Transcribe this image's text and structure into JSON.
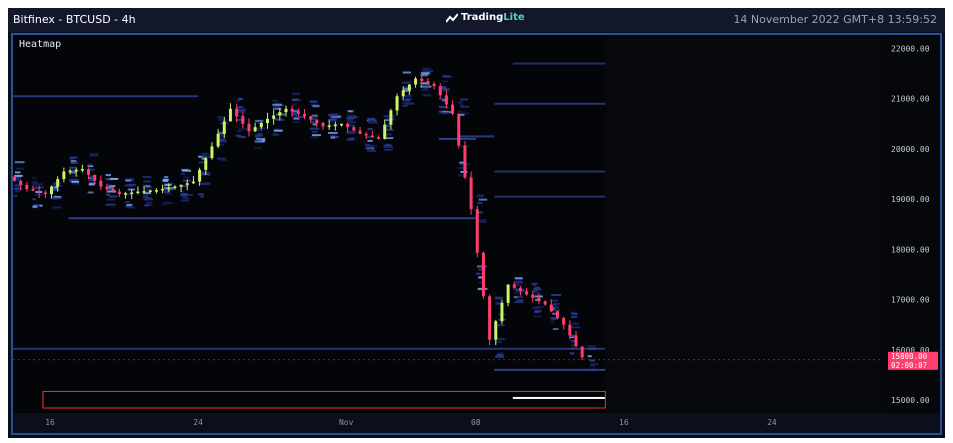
{
  "header": {
    "symbol": "Bitfinex - BTCUSD - 4h",
    "logo_text_a": "Trading",
    "logo_text_b": "Lite",
    "datetime": "14 November 2022 GMT+8 13:59:52"
  },
  "panel": {
    "label": "Heatmap"
  },
  "colors": {
    "background": "#030508",
    "up_candle": "#c8f56a",
    "down_candle": "#ff3d6e",
    "liquidity": "#3b4fb0",
    "highlight_box": "#ff2a2a",
    "price_tag": "#ff3d6e"
  },
  "chart_data": {
    "type": "heatmap",
    "title": "Heatmap",
    "ylim": [
      14800,
      22150
    ],
    "y_ticks": [
      "22000.00",
      "21000.00",
      "20000.00",
      "19000.00",
      "18000.00",
      "17000.00",
      "16000.00",
      "15000.00"
    ],
    "y_tick_values": [
      22000,
      21000,
      20000,
      19000,
      18000,
      17000,
      16000,
      15000
    ],
    "x_ticks": [
      "16",
      "24",
      "Nov",
      "08",
      "16",
      "24"
    ],
    "x_tick_dates": [
      "2022-10-16",
      "2022-10-24",
      "2022-11-01",
      "2022-11-08",
      "2022-11-16",
      "2022-11-24"
    ],
    "x_range_dates": [
      "2022-10-14",
      "2022-11-30"
    ],
    "last_price_label": "15800.00",
    "countdown_label": "02:00:07",
    "last_price": 15800,
    "series": [
      {
        "name": "",
        "description": "BTCUSD 4h close path",
        "points": [
          [
            "2022-10-14",
            19450
          ],
          [
            "2022-10-15",
            19200
          ],
          [
            "2022-10-16",
            19100
          ],
          [
            "2022-10-17",
            19550
          ],
          [
            "2022-10-18",
            19600
          ],
          [
            "2022-10-19",
            19250
          ],
          [
            "2022-10-20",
            19100
          ],
          [
            "2022-10-21",
            19150
          ],
          [
            "2022-10-22",
            19180
          ],
          [
            "2022-10-23",
            19250
          ],
          [
            "2022-10-24",
            19350
          ],
          [
            "2022-10-25",
            20050
          ],
          [
            "2022-10-26",
            20800
          ],
          [
            "2022-10-27",
            20350
          ],
          [
            "2022-10-28",
            20600
          ],
          [
            "2022-10-29",
            20800
          ],
          [
            "2022-10-30",
            20650
          ],
          [
            "2022-10-31",
            20450
          ],
          [
            "2022-11-01",
            20500
          ],
          [
            "2022-11-02",
            20300
          ],
          [
            "2022-11-03",
            20200
          ],
          [
            "2022-11-04",
            21050
          ],
          [
            "2022-11-05",
            21400
          ],
          [
            "2022-11-06",
            21250
          ],
          [
            "2022-11-07",
            20700
          ],
          [
            "2022-11-08",
            18800
          ],
          [
            "2022-11-09",
            16200
          ],
          [
            "2022-11-10",
            17300
          ],
          [
            "2022-11-11",
            17100
          ],
          [
            "2022-11-12",
            16900
          ],
          [
            "2022-11-13",
            16500
          ],
          [
            "2022-11-14",
            15850
          ]
        ]
      }
    ],
    "liquidity_levels": [
      {
        "price": 21050,
        "from": "2022-10-14",
        "to": "2022-10-24",
        "strength": 0.5
      },
      {
        "price": 18620,
        "from": "2022-10-17",
        "to": "2022-11-08",
        "strength": 0.7
      },
      {
        "price": 20200,
        "from": "2022-11-06",
        "to": "2022-11-08",
        "strength": 0.8
      },
      {
        "price": 20250,
        "from": "2022-11-07",
        "to": "2022-11-09",
        "strength": 0.6
      },
      {
        "price": 19550,
        "from": "2022-11-09",
        "to": "2022-11-15",
        "strength": 0.4
      },
      {
        "price": 19050,
        "from": "2022-11-09",
        "to": "2022-11-15",
        "strength": 0.4
      },
      {
        "price": 20900,
        "from": "2022-11-09",
        "to": "2022-11-15",
        "strength": 0.5
      },
      {
        "price": 16020,
        "from": "2022-10-14",
        "to": "2022-11-15",
        "strength": 0.5
      },
      {
        "price": 15600,
        "from": "2022-11-09",
        "to": "2022-11-15",
        "strength": 0.8
      },
      {
        "price": 21700,
        "from": "2022-11-10",
        "to": "2022-11-15",
        "strength": 0.3
      }
    ],
    "highlight": {
      "price_low": 14840,
      "price_high": 15170,
      "from": "2022-10-14",
      "to": "2022-11-15"
    },
    "bright_level": {
      "price": 15040,
      "from": "2022-11-10",
      "to": "2022-11-15"
    },
    "grid": false
  }
}
